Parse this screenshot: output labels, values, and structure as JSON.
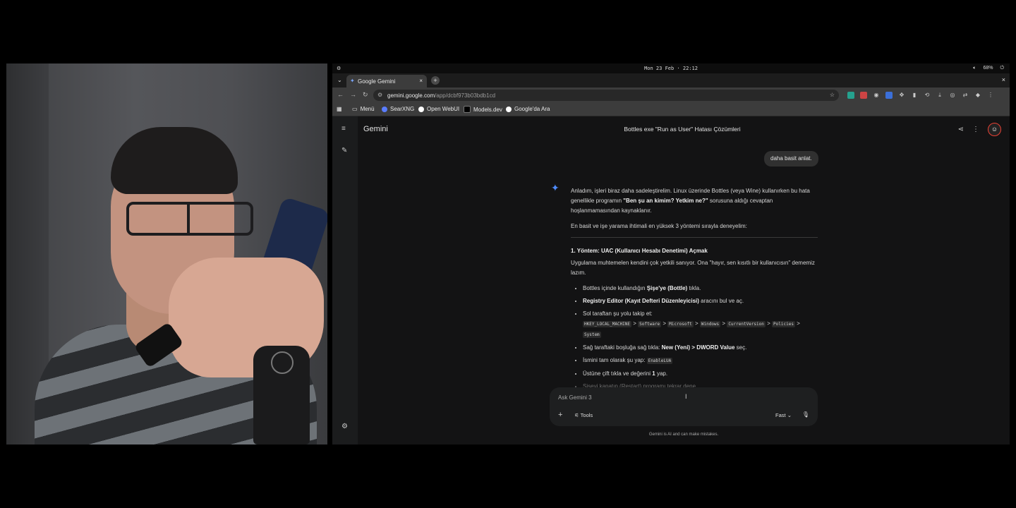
{
  "system_bar": {
    "datetime": "Mon 23 Feb · 22:12",
    "battery": "68%",
    "volume_icon": "speaker-icon",
    "power_icon": "power-icon"
  },
  "tab": {
    "title": "Google Gemini",
    "close": "×",
    "new_tab": "+"
  },
  "window": {
    "close": "×"
  },
  "address_bar": {
    "host": "gemini.google.com",
    "path": "/app/dcbf973b03bdb1cd"
  },
  "bookmarks": [
    {
      "label": "Menü",
      "color": "#c8c8c8"
    },
    {
      "label": "SearXNG",
      "color": "#5a7dff"
    },
    {
      "label": "Open WebUI",
      "color": "#ffffff"
    },
    {
      "label": "Models.dev",
      "color": "#222222"
    },
    {
      "label": "Google'da Ara",
      "color": "#ffffff"
    }
  ],
  "gemini": {
    "brand": "Gemini",
    "conversation_title": "Bottles exe \"Run as User\" Hatası Çözümleri",
    "user_message": "daha basit anlat.",
    "response": {
      "intro_1": "Anladım, işleri biraz daha sadeleştirelim. Linux üzerinde Bottles (veya Wine) kullanırken bu hata genellikle programın ",
      "intro_bold": "\"Ben şu an kimim? Yetkim ne?\"",
      "intro_2": " sorusuna aldığı cevaptan hoşlanmamasından kaynaklanır.",
      "intro_para2": "En basit ve işe yarama ihtimali en yüksek 3 yöntemi sırayla deneyelim:",
      "method_title": "1. Yöntem: UAC (Kullanıcı Hesabı Denetimi) Açmak",
      "method_desc": "Uygulama muhtemelen kendini çok yetkili sanıyor. Ona \"hayır, sen kısıtlı bir kullanıcısın\" dememiz lazım.",
      "b1_pre": "Bottles içinde kullandığın ",
      "b1_bold": "Şişe'ye (Bottle)",
      "b1_post": " tıkla.",
      "b2_bold": "Registry Editor (Kayıt Defteri Düzenleyicisi)",
      "b2_post": " aracını bul ve aç.",
      "b3": "Sol taraftan şu yolu takip et:",
      "path": [
        "HKEY_LOCAL_MACHINE",
        "Software",
        "Microsoft",
        "Windows",
        "CurrentVersion",
        "Policies",
        "System"
      ],
      "sep": ">",
      "b4_pre": "Sağ taraftaki boşluğa sağ tıkla: ",
      "b4_bold": "New (Yeni) > DWORD Value",
      "b4_post": " seç.",
      "b5_pre": "İsmini tam olarak şu yap: ",
      "b5_code": "EnableLUA",
      "b6_pre": "Üstüne çift tıkla ve değerini ",
      "b6_bold": "1",
      "b6_post": " yap.",
      "b7": "Şişeyi kapatıp (Restart) programı tekrar dene."
    },
    "input": {
      "placeholder": "Ask Gemini 3",
      "tools": "Tools",
      "mode": "Fast"
    },
    "disclaimer": "Gemini is AI and can make mistakes."
  }
}
